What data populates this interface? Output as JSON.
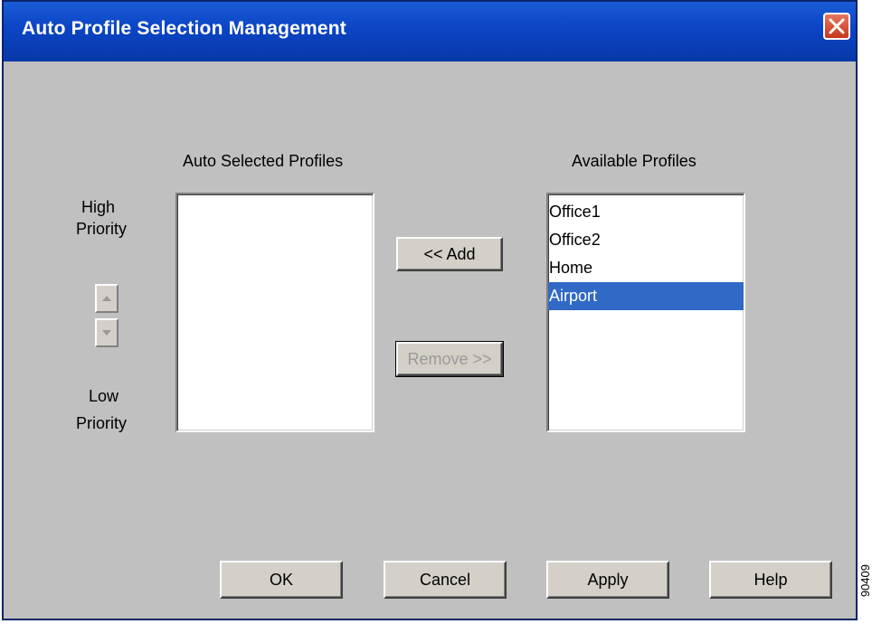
{
  "window": {
    "title": "Auto Profile Selection Management"
  },
  "auto_selected": {
    "header": "Auto Selected Profiles",
    "items": []
  },
  "available": {
    "header": "Available Profiles",
    "items": [
      "Office1",
      "Office2",
      "Home",
      "Airport"
    ],
    "selected": "Airport"
  },
  "priority": {
    "high_line1": "High",
    "high_line2": "Priority",
    "low_line1": "Low",
    "low_line2": "Priority"
  },
  "buttons": {
    "add": "<< Add",
    "remove": "Remove >>",
    "ok": "OK",
    "cancel": "Cancel",
    "apply": "Apply",
    "help": "Help"
  },
  "figure_id": "90409",
  "colors": {
    "titlebar": "#0b44c4",
    "selection": "#3169c6",
    "dialog_face": "#c0c0c0"
  }
}
